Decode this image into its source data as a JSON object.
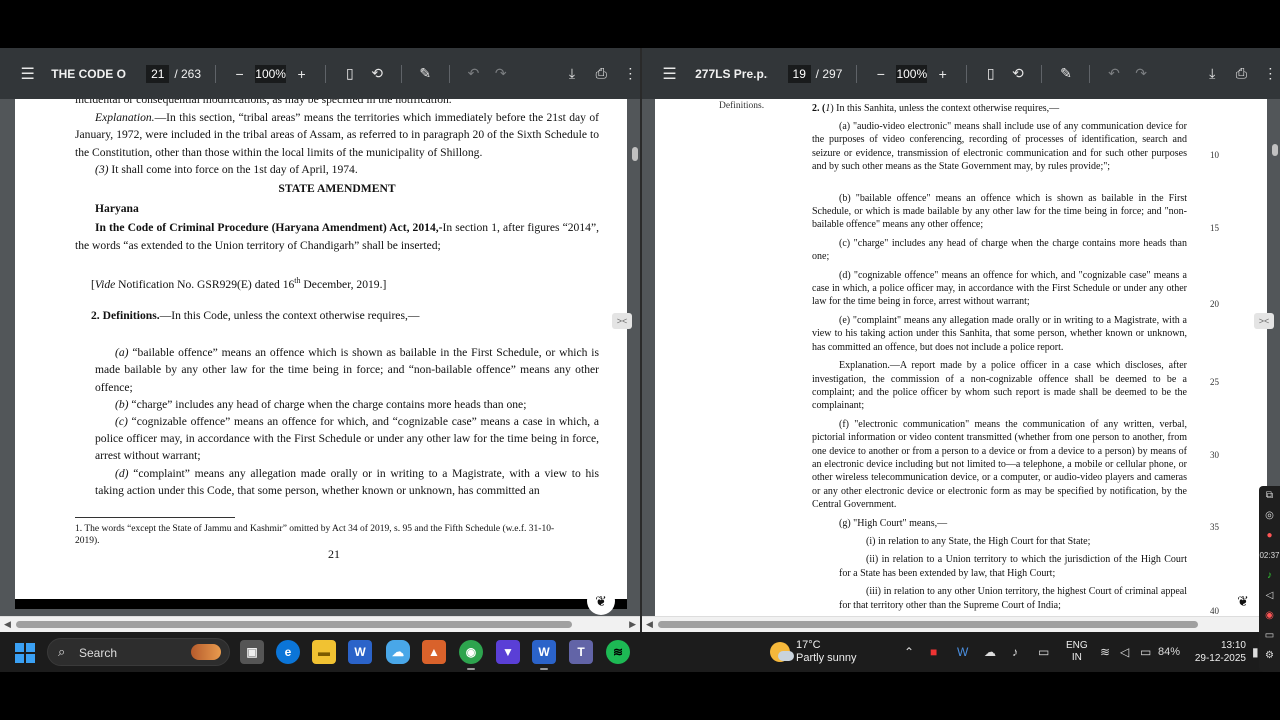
{
  "left_viewer": {
    "title": "THE CODE O...",
    "page": "21",
    "total": "/ 263",
    "zoom": "100%",
    "page_number": "21",
    "lines": {
      "l0": "incidental or consequential modifications, as may be specified in the notification.",
      "explanation_label": "Explanation.",
      "explanation": "—In this section, “tribal areas” means the territories which immediately before the 21st day of January, 1972, were included in the tribal areas of Assam, as referred to in paragraph 20 of the Sixth Schedule to the Constitution, other than those within the local limits of the municipality of Shillong.",
      "sub3_num": "(3)",
      "sub3": " It shall come into force on the 1st day of April, 1974.",
      "state_amendment": "STATE AMENDMENT",
      "haryana": "Haryana",
      "haryana_act": "In the Code of Criminal Procedure (Haryana Amendment) Act, 2014,-",
      "haryana_text": "In section 1, after figures “2014”, the words “as extended to the Union territory of Chandigarh” shall be inserted;",
      "vide_label": "Vide",
      "vide": " Notification No. GSR929(E) dated 16",
      "vide_sup": "th",
      "vide_end": " December, 2019.]",
      "defs_head": "2. Definitions.",
      "defs_text": "—In this Code, unless the context otherwise requires,—",
      "a_num": "(a)",
      "a_text": " “bailable offence” means an offence which is shown as bailable in the First Schedule, or which is made bailable by any other law for the time being in force; and “non-bailable offence” means any other offence;",
      "b_num": "(b)",
      "b_text": " “charge” includes any head of charge when the charge contains more heads than one;",
      "c_num": "(c)",
      "c_text": " “cognizable offence” means an offence for which, and “cognizable case” means a case in which, a police officer may, in accordance with the First Schedule or under any other law for the time being in force, arrest without warrant;",
      "d_num": "(d)",
      "d_text": " “complaint” means any allegation made orally or in writing to a Magistrate, with a view to his taking action under this Code, that some person, whether known or unknown, has committed an",
      "footnote": "1. The words “except the State of Jammu and Kashmir” omitted by Act 34 of 2019, s. 95 and the Fifth Schedule (w.e.f. 31-10- 2019)."
    }
  },
  "right_viewer": {
    "title": "277LS Pre.p...",
    "page": "19",
    "total": "/ 297",
    "zoom": "100%",
    "margin_note": "Definitions.",
    "lines": {
      "head_num": "2. (",
      "head_i": "1",
      "head": ") In this Sanhita, unless the context otherwise requires,—",
      "a": "(a) \"audio-video electronic\" means shall include use of any communication device for the purposes of video conferencing, recording of processes of identification, search and seizure or evidence, transmission of electronic communication and for such other purposes and by such other means as the State Government may, by rules provide;\";",
      "b": "(b) \"bailable offence\" means an offence which is shown as bailable in the First Schedule, or which is made bailable by any other law for the time being in force; and \"non-bailable offence\" means any other offence;",
      "c": "(c) \"charge\" includes any head of charge when the charge contains more heads than one;",
      "d": "(d) \"cognizable offence\" means an offence for which, and \"cognizable case\" means a case in which, a police officer may, in accordance with the First Schedule or under any other law for the time being in force, arrest without warrant;",
      "e": "(e) \"complaint\" means any allegation made orally or in writing to a Magistrate, with a view to his taking action under this Sanhita, that some person, whether known or unknown, has committed an offence, but does not include a police report.",
      "expl": "Explanation.—A report made by a police officer in a case which discloses, after investigation, the commission of a non-cognizable offence shall be deemed to be a complaint; and the police officer by whom such report is made shall be deemed to be the complainant;",
      "f": "(f) \"electronic communication\" means the communication of any written, verbal, pictorial information or video content transmitted (whether from one person to another, from one device to another or from a person to a device or from a device to a person) by means of an electronic device including but not limited to—a telephone, a mobile or cellular phone, or other wireless telecommunication device, or a computer, or audio-video players and cameras or any other electronic device or electronic form as may be specified by notification, by the Central Government.",
      "g": "(g) \"High Court\" means,—",
      "g_i": "(i) in relation to any State, the High Court for that State;",
      "g_ii": "(ii) in relation to a Union territory to which the jurisdiction of the High Court for a State has been extended by law, that High Court;",
      "g_iii": "(iii) in relation to any other Union territory, the highest Court of criminal appeal for that territory other than the Supreme Court of India;"
    },
    "line_numbers": [
      "10",
      "15",
      "20",
      "25",
      "30",
      "35",
      "40"
    ]
  },
  "taskbar": {
    "search_label": "Search",
    "weather_temp": "17°C",
    "weather_desc": "Partly sunny",
    "lang1": "ENG",
    "lang2": "IN",
    "battery": "84%",
    "time": "13:10",
    "date": "29-12-2025",
    "side_time": "02:37"
  },
  "colors": {
    "toolbar_bg": "#323639",
    "viewer_bg": "#525659",
    "taskbar_bg": "#1c1c1c",
    "accent": "#3aa0f3"
  }
}
